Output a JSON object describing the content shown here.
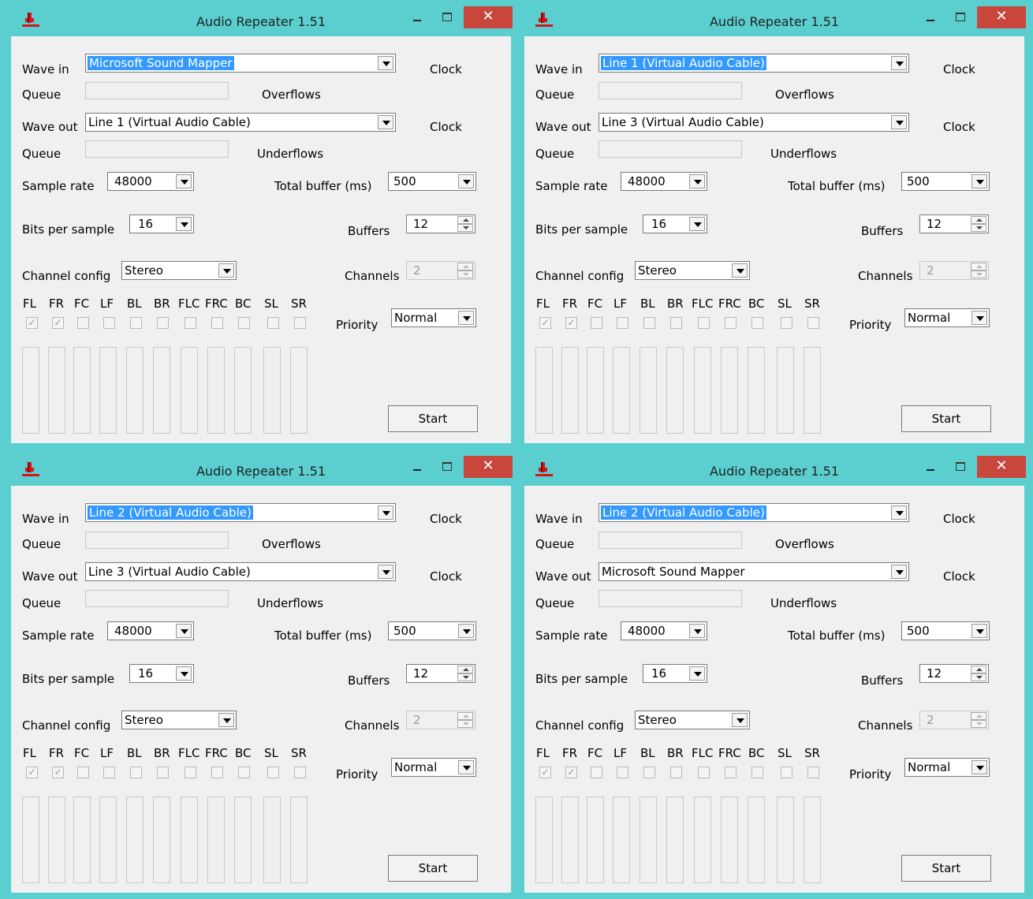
{
  "labels": {
    "wave_in": "Wave in",
    "queue": "Queue",
    "overflows": "Overflows",
    "clock": "Clock",
    "wave_out": "Wave out",
    "underflows": "Underflows",
    "sample_rate": "Sample rate",
    "total_buffer": "Total buffer (ms)",
    "bits_per_sample": "Bits per sample",
    "buffers": "Buffers",
    "channel_config": "Channel config",
    "channels": "Channels",
    "priority": "Priority",
    "start": "Start",
    "close_glyph": "✕"
  },
  "channel_names": [
    "FL",
    "FR",
    "FC",
    "LF",
    "BL",
    "BR",
    "FLC",
    "FRC",
    "BC",
    "SL",
    "SR"
  ],
  "windows": [
    {
      "title": "Audio Repeater 1.51",
      "wave_in": "Microsoft Sound Mapper",
      "wave_out": "Line 1 (Virtual Audio Cable)",
      "sample_rate": "48000",
      "total_buffer": "500",
      "bits": "16",
      "buffers": "12",
      "channel_config": "Stereo",
      "channels": "2",
      "priority": "Normal",
      "checked": [
        true,
        true,
        false,
        false,
        false,
        false,
        false,
        false,
        false,
        false,
        false
      ]
    },
    {
      "title": "Audio Repeater 1.51",
      "wave_in": "Line 1 (Virtual Audio Cable)",
      "wave_out": "Line 3 (Virtual Audio Cable)",
      "sample_rate": "48000",
      "total_buffer": "500",
      "bits": "16",
      "buffers": "12",
      "channel_config": "Stereo",
      "channels": "2",
      "priority": "Normal",
      "checked": [
        true,
        true,
        false,
        false,
        false,
        false,
        false,
        false,
        false,
        false,
        false
      ]
    },
    {
      "title": "Audio Repeater 1.51",
      "wave_in": "Line 2 (Virtual Audio Cable)",
      "wave_out": "Line 3 (Virtual Audio Cable)",
      "sample_rate": "48000",
      "total_buffer": "500",
      "bits": "16",
      "buffers": "12",
      "channel_config": "Stereo",
      "channels": "2",
      "priority": "Normal",
      "checked": [
        true,
        true,
        false,
        false,
        false,
        false,
        false,
        false,
        false,
        false,
        false
      ]
    },
    {
      "title": "Audio Repeater 1.51",
      "wave_in": "Line 2 (Virtual Audio Cable)",
      "wave_out": "Microsoft Sound Mapper",
      "sample_rate": "48000",
      "total_buffer": "500",
      "bits": "16",
      "buffers": "12",
      "channel_config": "Stereo",
      "channels": "2",
      "priority": "Normal",
      "checked": [
        true,
        true,
        false,
        false,
        false,
        false,
        false,
        false,
        false,
        false,
        false
      ]
    }
  ]
}
